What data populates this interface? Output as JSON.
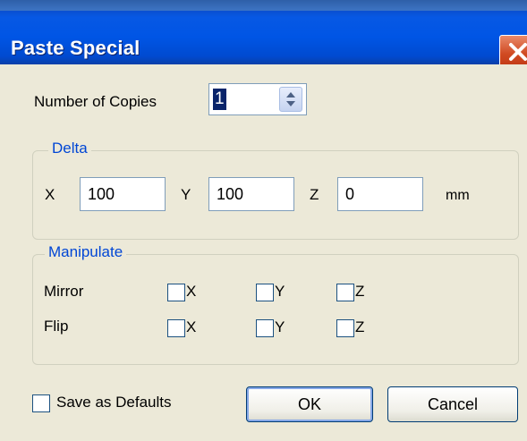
{
  "window": {
    "title": "Paste Special"
  },
  "copies": {
    "label": "Number of Copies",
    "value": "1"
  },
  "delta": {
    "title": "Delta",
    "x_label": "X",
    "x_value": "100",
    "y_label": "Y",
    "y_value": "100",
    "z_label": "Z",
    "z_value": "0",
    "unit": "mm"
  },
  "manipulate": {
    "title": "Manipulate",
    "mirror": {
      "label": "Mirror",
      "x": "X",
      "y": "Y",
      "z": "Z",
      "x_checked": false,
      "y_checked": false,
      "z_checked": false
    },
    "flip": {
      "label": "Flip",
      "x": "X",
      "y": "Y",
      "z": "Z",
      "x_checked": false,
      "y_checked": false,
      "z_checked": false
    }
  },
  "footer": {
    "save_defaults_label": "Save as Defaults",
    "save_defaults_checked": false,
    "ok_label": "OK",
    "cancel_label": "Cancel"
  },
  "icons": {
    "close": "close-icon",
    "spin_up": "spin-up-icon",
    "spin_down": "spin-down-icon"
  },
  "colors": {
    "title_bar": "#0055e5",
    "close_button": "#d04a22",
    "group_title": "#0046d5",
    "dialog_background": "#ece9d8"
  }
}
